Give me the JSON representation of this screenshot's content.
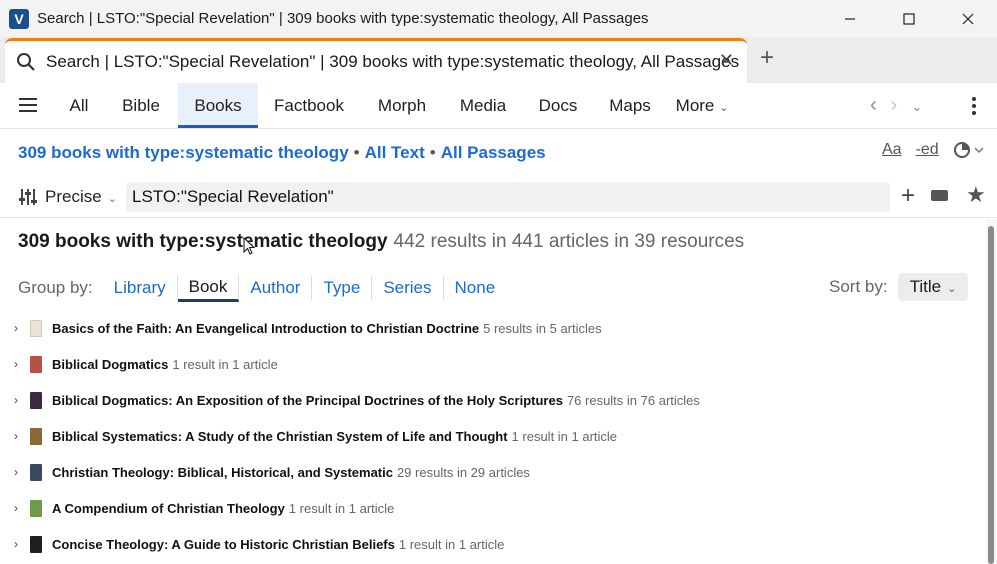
{
  "window": {
    "title": "Search | LSTO:\"Special Revelation\" | 309 books with type:systematic theology, All Passages"
  },
  "tab": {
    "title": "Search | LSTO:\"Special Revelation\" | 309 books with type:systematic theology, All Passages"
  },
  "nav": {
    "tabs": [
      "All",
      "Bible",
      "Books",
      "Factbook",
      "Morph",
      "Media",
      "Docs",
      "Maps",
      "More"
    ],
    "active": "Books"
  },
  "scope": {
    "resources": "309 books with type:systematic theology",
    "text": "All Text",
    "passages": "All Passages"
  },
  "search": {
    "mode": "Precise",
    "query": "LSTO:\"Special Revelation\""
  },
  "results": {
    "heading": "309 books with type:systematic theology",
    "summary": "442 results in 441 articles in 39 resources"
  },
  "groupby": {
    "label": "Group by:",
    "options": [
      "Library",
      "Book",
      "Author",
      "Type",
      "Series",
      "None"
    ],
    "active": "Book"
  },
  "sortby": {
    "label": "Sort by:",
    "value": "Title"
  },
  "books": [
    {
      "title": "Basics of the Faith: An Evangelical Introduction to Christian Doctrine",
      "hits": "5 results in 5 articles",
      "cover_color": "#e9e4d6"
    },
    {
      "title": "Biblical Dogmatics",
      "hits": "1 result in 1 article",
      "cover_color": "#b8504a"
    },
    {
      "title": "Biblical Dogmatics: An Exposition of the Principal Doctrines of the Holy Scriptures",
      "hits": "76 results in 76 articles",
      "cover_color": "#3a2a3e"
    },
    {
      "title": "Biblical Systematics: A Study of the Christian System of Life and Thought",
      "hits": "1 result in 1 article",
      "cover_color": "#8a6a34"
    },
    {
      "title": "Christian Theology: Biblical, Historical, and Systematic",
      "hits": "29 results in 29 articles",
      "cover_color": "#3b4a63"
    },
    {
      "title": "A Compendium of Christian Theology",
      "hits": "1 result in 1 article",
      "cover_color": "#6f9a4e"
    },
    {
      "title": "Concise Theology: A Guide to Historic Christian Beliefs",
      "hits": "1 result in 1 article",
      "cover_color": "#1e1e22"
    }
  ],
  "colors": {
    "accent_blue": "#1c6ad6",
    "tab_underline": "#f07e1b"
  }
}
